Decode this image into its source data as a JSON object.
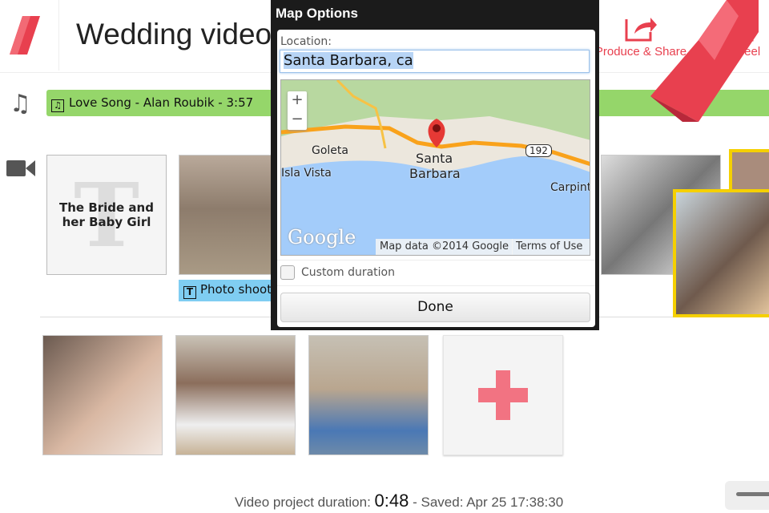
{
  "header": {
    "title": "Wedding video",
    "produce_label": "Produce & Share",
    "unreel_label": "Unreel"
  },
  "music": {
    "track": "Love Song - Alan Roubik - 3:57",
    "note_glyph": "♫"
  },
  "timeline": {
    "title_card": "The Bride and her Baby Girl",
    "title_card_letter": "T",
    "caption": "Photo shoot",
    "caption_glyph": "T"
  },
  "footer": {
    "duration_label": "Video project duration:",
    "duration": "0:48",
    "saved": "- Saved: Apr 25 17:38:30"
  },
  "dialog": {
    "title": "Map Options",
    "location_label": "Location:",
    "location_value": "Santa Barbara, ca",
    "map": {
      "zoom_in": "+",
      "zoom_out": "−",
      "labels": [
        "Goleta",
        "Isla Vista",
        "Santa",
        "Barbara",
        "192",
        "Carpint"
      ],
      "google": "Google",
      "attribution": "Map data ©2014 Google",
      "terms": "Terms of Use"
    },
    "custom_duration_label": "Custom duration",
    "custom_duration_checked": false,
    "done_label": "Done"
  },
  "colors": {
    "accent": "#e8404f",
    "music_bar": "#95d66a",
    "caption": "#7fcdf2",
    "selected": "#f5d000"
  }
}
